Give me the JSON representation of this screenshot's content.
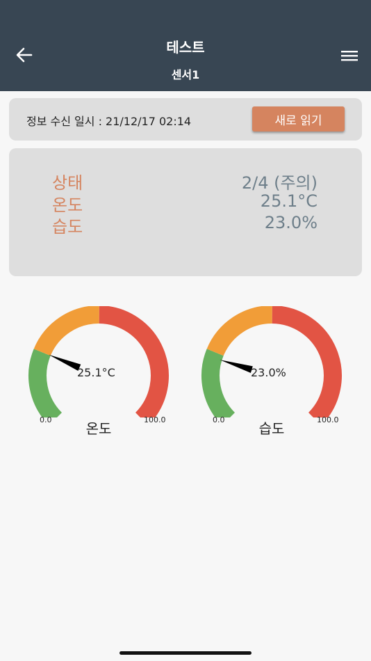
{
  "header": {
    "title": "테스트",
    "subtitle": "센서1",
    "back_icon": "arrow-left-icon",
    "menu_icon": "hamburger-menu-icon"
  },
  "info": {
    "received_text": "정보 수신 일시 : 21/12/17 02:14",
    "refresh_label": "새로 읽기"
  },
  "status": {
    "rows": [
      {
        "label": "상태",
        "value": "2/4 (주의)"
      },
      {
        "label": "온도",
        "value": "25.1°C"
      },
      {
        "label": "습도",
        "value": "23.0%"
      }
    ]
  },
  "gauges": [
    {
      "name": "온도",
      "value_text": "25.1°C",
      "value": 25.1,
      "min": 0,
      "max": 100,
      "min_label": "0.0",
      "max_label": "100.0"
    },
    {
      "name": "습도",
      "value_text": "23.0%",
      "value": 23.0,
      "min": 0,
      "max": 100,
      "min_label": "0.0",
      "max_label": "100.0"
    }
  ],
  "colors": {
    "header_bg": "#384653",
    "accent": "#d5845f",
    "value_text": "#6e7f8a",
    "gauge_green": "#67b05e",
    "gauge_orange": "#f19d38",
    "gauge_red": "#e25444"
  }
}
